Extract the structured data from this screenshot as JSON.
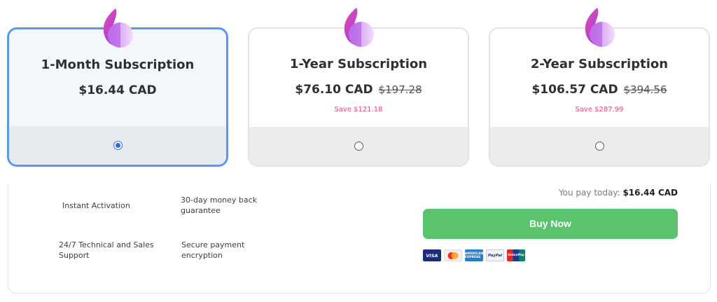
{
  "plans": [
    {
      "title": "1-Month Subscription",
      "price": "$16.44 CAD",
      "old_price": "",
      "save": "",
      "selected": true
    },
    {
      "title": "1-Year Subscription",
      "price": "$76.10 CAD",
      "old_price": "$197.28",
      "save": "Save $121.18",
      "selected": false
    },
    {
      "title": "2-Year Subscription",
      "price": "$106.57 CAD",
      "old_price": "$394.56",
      "save": "Save $287.99",
      "selected": false
    }
  ],
  "features": {
    "instant_activation": "Instant Activation",
    "money_back_line1": "30-day money back",
    "money_back_line2": "guarantee",
    "support_line1": "24/7 Technical and Sales",
    "support_line2": "Support",
    "secure_line1": "Secure payment",
    "secure_line2": "encryption"
  },
  "checkout": {
    "pay_today_label": "You pay today:",
    "pay_today_amount": "$16.44 CAD",
    "buy_label": "Buy Now"
  },
  "payment_methods": {
    "visa": "VISA",
    "mastercard": "",
    "amex": "AMERICAN EXPRESS",
    "paypal": "PayPal",
    "unionpay": "UnionPay"
  },
  "colors": {
    "accent_border": "#5b97ea",
    "buy_button": "#5bc26d",
    "save_text": "#e04a76",
    "logo_gradient": [
      "#d43fc0",
      "#8f3fe0"
    ]
  }
}
